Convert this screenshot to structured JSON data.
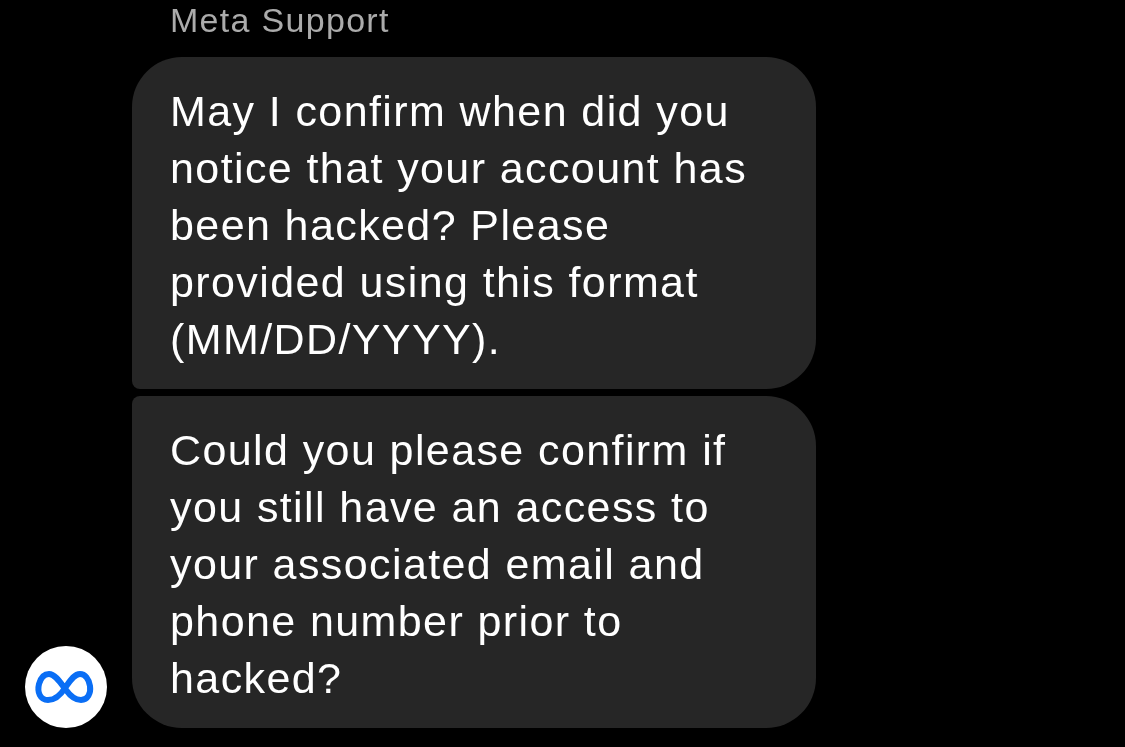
{
  "conversation": {
    "sender_name": "Meta Support",
    "messages": [
      {
        "lines": [
          "May I confirm when did you",
          "notice that your account has",
          "been hacked? Please",
          "provided using this format",
          "(MM/DD/YYYY)."
        ]
      },
      {
        "lines": [
          "Could you please confirm if",
          "you still have an access to",
          "your associated email and",
          "phone number prior to",
          "hacked?"
        ]
      }
    ]
  }
}
